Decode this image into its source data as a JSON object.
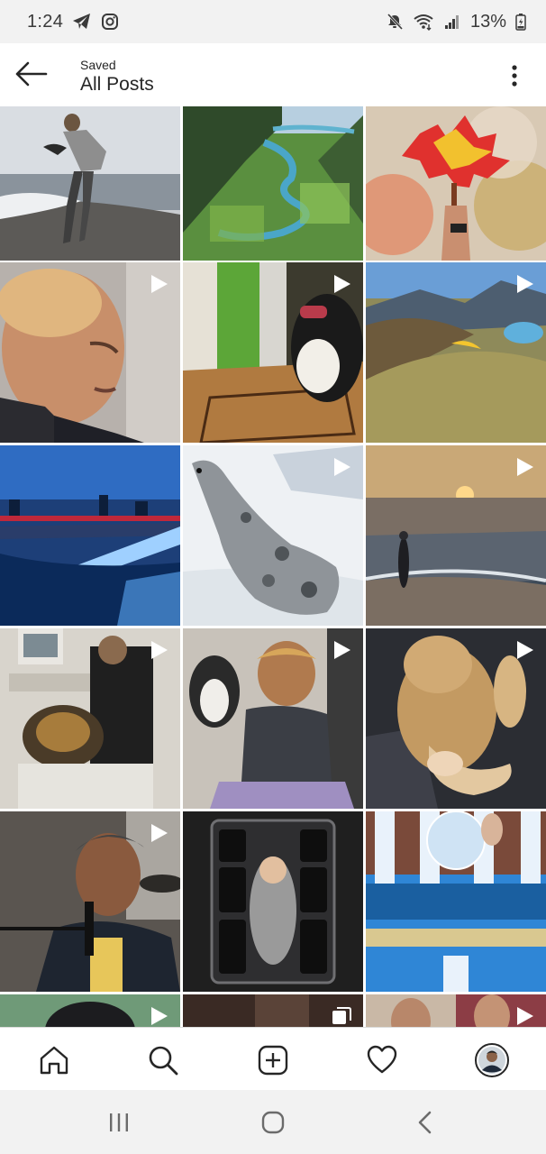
{
  "status_bar": {
    "time": "1:24",
    "battery": "13%",
    "left_icons": [
      "telegram-icon",
      "instagram-icon"
    ],
    "right_icons": [
      "mute-icon",
      "wifi-icon",
      "signal-icon",
      "battery-icon"
    ]
  },
  "header": {
    "subtitle": "Saved",
    "title": "All Posts",
    "back_icon": "arrow-left-icon",
    "menu_icon": "more-vertical-icon"
  },
  "grid": {
    "posts": [
      {
        "subject": "woman with bird on beach",
        "type": "video"
      },
      {
        "subject": "valley with winding river",
        "type": "photo"
      },
      {
        "subject": "lego maple leaf",
        "type": "photo"
      },
      {
        "subject": "elderly man portrait",
        "type": "video"
      },
      {
        "subject": "dog in doorway",
        "type": "video"
      },
      {
        "subject": "paraglider over mountains",
        "type": "video"
      },
      {
        "subject": "city bridge at dusk",
        "type": "photo"
      },
      {
        "subject": "seal on snow",
        "type": "video"
      },
      {
        "subject": "woman on beach at sunset",
        "type": "video"
      },
      {
        "subject": "vet with german shepherd",
        "type": "video"
      },
      {
        "subject": "woman planking with husky",
        "type": "video"
      },
      {
        "subject": "sleeping puppy",
        "type": "video"
      },
      {
        "subject": "man singing at microphone",
        "type": "video"
      },
      {
        "subject": "baby in camera bag",
        "type": "photo"
      },
      {
        "subject": "crystal ball reflection",
        "type": "photo"
      },
      {
        "subject": "man portrait",
        "type": "video"
      },
      {
        "subject": "dark scene",
        "type": "carousel"
      },
      {
        "subject": "man face collage",
        "type": "video"
      }
    ]
  },
  "bottom_nav": {
    "items": [
      "home-icon",
      "search-icon",
      "new-post-icon",
      "activity-heart-icon",
      "profile-avatar"
    ]
  },
  "system_nav": {
    "items": [
      "recent-apps-icon",
      "home-circle-icon",
      "back-chevron-icon"
    ]
  },
  "colors": {
    "text": "#262626",
    "bar_background": "#f2f2f2",
    "divider": "#dbdbdb"
  }
}
